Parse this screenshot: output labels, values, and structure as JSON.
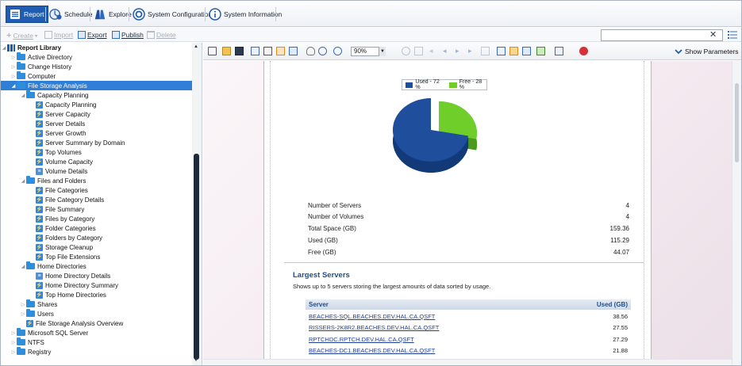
{
  "nav": {
    "tabs": [
      {
        "label": "Report",
        "icon": "report-list-icon"
      },
      {
        "label": "Schedule",
        "icon": "schedule-icon"
      },
      {
        "label": "Explore",
        "icon": "binoculars-icon"
      },
      {
        "label": "System Configuration",
        "icon": "gear-icon"
      },
      {
        "label": "System Information",
        "icon": "info-icon"
      }
    ],
    "active_tab": "Report"
  },
  "actions": {
    "create": "Create",
    "import": "Import",
    "export": "Export",
    "publish": "Publish",
    "delete": "Delete"
  },
  "search": {
    "value": "",
    "placeholder": ""
  },
  "tree": {
    "root": "Report Library",
    "items": [
      {
        "label": "Active Directory",
        "type": "folder",
        "level": 1
      },
      {
        "label": "Change History",
        "type": "folder",
        "level": 1
      },
      {
        "label": "Computer",
        "type": "folder",
        "level": 1
      },
      {
        "label": "File Storage Analysis",
        "type": "folder",
        "level": 1,
        "selected": true
      },
      {
        "label": "Capacity Planning",
        "type": "folder",
        "level": 2
      },
      {
        "label": "Capacity Planning",
        "type": "report",
        "level": 3
      },
      {
        "label": "Server Capacity",
        "type": "report",
        "level": 3
      },
      {
        "label": "Server Details",
        "type": "report",
        "level": 3
      },
      {
        "label": "Server Growth",
        "type": "report",
        "level": 3
      },
      {
        "label": "Server Summary by Domain",
        "type": "report",
        "level": 3
      },
      {
        "label": "Top Volumes",
        "type": "report",
        "level": 3
      },
      {
        "label": "Volume Capacity",
        "type": "report",
        "level": 3
      },
      {
        "label": "Volume Details",
        "type": "table",
        "level": 3
      },
      {
        "label": "Files and Folders",
        "type": "folder",
        "level": 2
      },
      {
        "label": "File Categories",
        "type": "report",
        "level": 3
      },
      {
        "label": "File Category Details",
        "type": "report",
        "level": 3
      },
      {
        "label": "File Summary",
        "type": "report",
        "level": 3
      },
      {
        "label": "Files by Category",
        "type": "report",
        "level": 3
      },
      {
        "label": "Folder Categories",
        "type": "report",
        "level": 3
      },
      {
        "label": "Folders by Category",
        "type": "report",
        "level": 3
      },
      {
        "label": "Storage Cleanup",
        "type": "report",
        "level": 3
      },
      {
        "label": "Top File Extensions",
        "type": "report",
        "level": 3
      },
      {
        "label": "Home Directories",
        "type": "folder",
        "level": 2
      },
      {
        "label": "Home Directory Details",
        "type": "table",
        "level": 3
      },
      {
        "label": "Home Directory Summary",
        "type": "report",
        "level": 3
      },
      {
        "label": "Top Home Directories",
        "type": "report",
        "level": 3
      },
      {
        "label": "Shares",
        "type": "folder",
        "level": 2
      },
      {
        "label": "Users",
        "type": "folder",
        "level": 2
      },
      {
        "label": "File Storage Analysis Overview",
        "type": "report",
        "level": 2
      },
      {
        "label": "Microsoft SQL Server",
        "type": "folder",
        "level": 1
      },
      {
        "label": "NTFS",
        "type": "folder",
        "level": 1
      },
      {
        "label": "Registry",
        "type": "folder",
        "level": 1
      }
    ]
  },
  "viewer": {
    "zoom": "90%",
    "show_parameters": "Show Parameters"
  },
  "chart_data": {
    "type": "pie",
    "categories": [
      "Used - 72 %",
      "Free - 28 %"
    ],
    "values": [
      72,
      28
    ],
    "colors": [
      "#1f4f9c",
      "#6fce2a"
    ],
    "legend": "top"
  },
  "summary": [
    {
      "label": "Number of Servers",
      "value": "4"
    },
    {
      "label": "Number of Volumes",
      "value": "4"
    },
    {
      "label": "Total Space (GB)",
      "value": "159.36"
    },
    {
      "label": "Used (GB)",
      "value": "115.29"
    },
    {
      "label": "Free (GB)",
      "value": "44.07"
    }
  ],
  "largest_servers": {
    "title": "Largest Servers",
    "description": "Shows up to 5 servers storing the largest amounts of data sorted by usage.",
    "col_server": "Server",
    "col_used": "Used (GB)",
    "rows": [
      {
        "server": "BEACHES-SQL.BEACHES.DEV.HAL.CA.QSFT",
        "used": "38.56"
      },
      {
        "server": "RISSERS-2K8R2.BEACHES.DEV.HAL.CA.QSFT",
        "used": "27.55"
      },
      {
        "server": "RPTCHDC.RPTCH.DEV.HAL.CA.QSFT",
        "used": "27.29"
      },
      {
        "server": "BEACHES-DC1.BEACHES.DEV.HAL.CA.QSFT",
        "used": "21.88"
      }
    ]
  }
}
